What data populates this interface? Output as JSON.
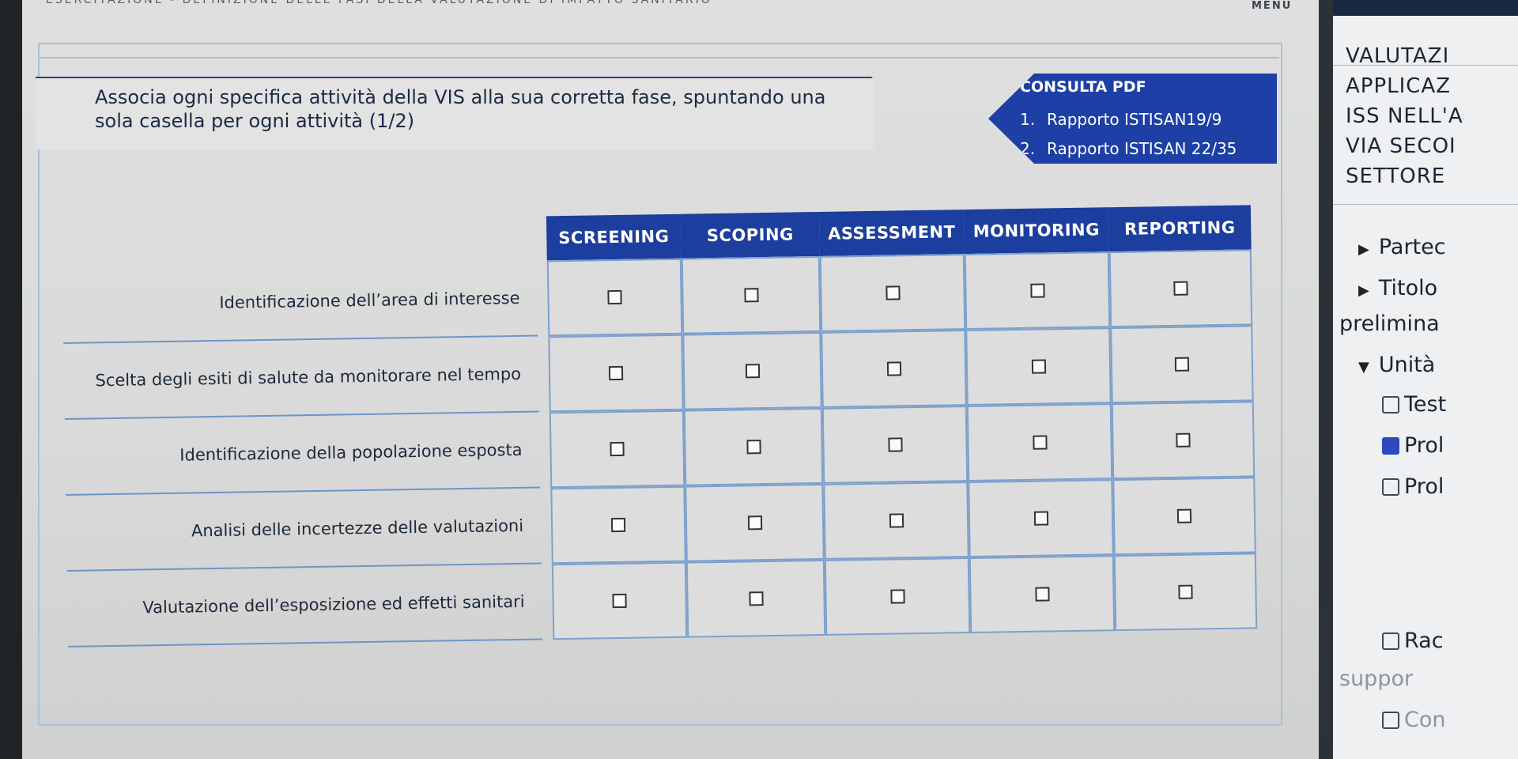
{
  "top_title": "ESERCITAZIONE - DEFINIZIONE DELLE FASI DELLA VALUTAZIONE DI IMPATTO SANITARIO",
  "menu_label": "MENU",
  "instruction": "Associa ogni specifica attività della VIS alla sua corretta fase, spuntando una sola casella per ogni attività (1/2)",
  "pdf": {
    "title": "CONSULTA PDF",
    "items": [
      {
        "num": "1.",
        "label": "Rapporto ISTISAN19/9"
      },
      {
        "num": "2.",
        "label": "Rapporto ISTISAN 22/35"
      }
    ]
  },
  "columns": [
    "SCREENING",
    "SCOPING",
    "ASSESSMENT",
    "MONITORING",
    "REPORTING"
  ],
  "rows": [
    "Identificazione dell’area di interesse",
    "Scelta degli esiti di salute da monitorare nel tempo",
    "Identificazione della popolazione esposta",
    "Analisi delle incertezze delle valutazioni",
    "Valutazione dell’esposizione ed effetti sanitari"
  ],
  "sidebar": {
    "title_lines": [
      "VALUTAZI",
      "APPLICAZ",
      "ISS NELL'A",
      "VIA SECOI",
      "SETTORE"
    ],
    "items": [
      {
        "label": "Partec",
        "icon": "triangle-right"
      },
      {
        "label": "Titolo",
        "icon": "triangle-right"
      },
      {
        "label": "prelimina",
        "icon": "none"
      },
      {
        "label": "Unità",
        "icon": "triangle-down"
      },
      {
        "label": "Test",
        "icon": "quiz-icon"
      },
      {
        "label": "Prol",
        "icon": "media-icon"
      },
      {
        "label": "Prol",
        "icon": "pdf-icon"
      },
      {
        "label": "Rac",
        "icon": "folder-icon"
      },
      {
        "label": "suppor",
        "icon": "none"
      },
      {
        "label": "Con",
        "icon": "document-icon"
      }
    ]
  },
  "colors": {
    "header_blue": "#1c3e9e",
    "pdf_blue": "#1d3fa6",
    "grid_blue": "#7da0cc"
  }
}
